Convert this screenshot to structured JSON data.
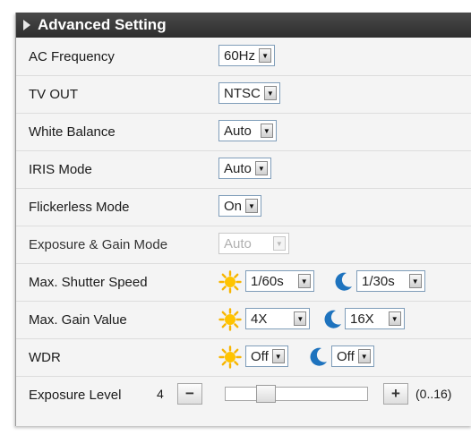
{
  "header": {
    "title": "Advanced Setting"
  },
  "rows": {
    "ac_frequency": {
      "label": "AC Frequency",
      "value": "60Hz"
    },
    "tv_out": {
      "label": "TV OUT",
      "value": "NTSC"
    },
    "white_balance": {
      "label": "White Balance",
      "value": "Auto"
    },
    "iris_mode": {
      "label": "IRIS Mode",
      "value": "Auto"
    },
    "flickerless_mode": {
      "label": "Flickerless Mode",
      "value": "On"
    },
    "exposure_gain_mode": {
      "label": "Exposure & Gain Mode",
      "value": "Auto"
    },
    "max_shutter_speed": {
      "label": "Max. Shutter Speed",
      "day_value": "1/60s",
      "night_value": "1/30s"
    },
    "max_gain_value": {
      "label": "Max. Gain Value",
      "day_value": "4X",
      "night_value": "16X"
    },
    "wdr": {
      "label": "WDR",
      "day_value": "Off",
      "night_value": "Off"
    },
    "exposure_level": {
      "label": "Exposure Level",
      "value": "4",
      "minus": "−",
      "plus": "+",
      "range": "(0..16)",
      "min": 0,
      "max": 16
    }
  },
  "icons": {
    "day": "sun-icon",
    "night": "moon-icon",
    "dropdown": "dropdown-arrow-icon"
  },
  "colors": {
    "header_bg": "#3a3a3a",
    "sun": "#f7b500",
    "moon": "#1e73be",
    "panel_bg": "#f4f4f4"
  }
}
